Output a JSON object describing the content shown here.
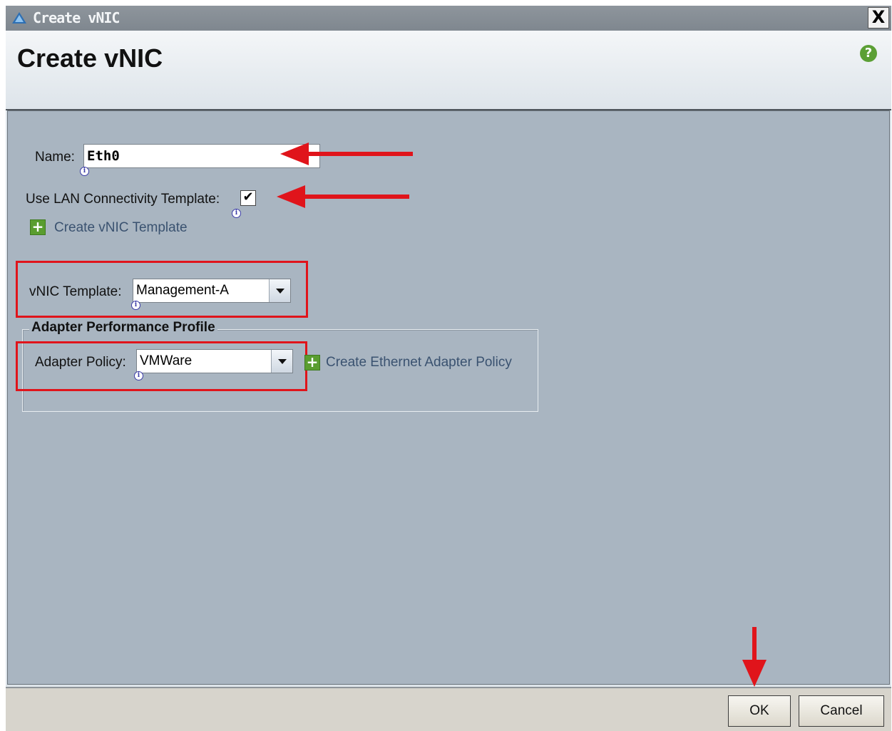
{
  "window": {
    "title": "Create vNIC",
    "close_label": "X"
  },
  "header": {
    "heading": "Create vNIC",
    "help_label": "?"
  },
  "form": {
    "name_label": "Name:",
    "name_value": "Eth0",
    "use_template_label": "Use LAN Connectivity Template:",
    "use_template_checked": true,
    "checkmark": "✔",
    "create_template_link": "Create vNIC Template",
    "vnic_template_label": "vNIC Template:",
    "vnic_template_value": "Management-A",
    "adapter_group_title": "Adapter Performance Profile",
    "adapter_policy_label": "Adapter Policy:",
    "adapter_policy_value": "VMWare",
    "create_adapter_policy_link": "Create Ethernet Adapter Policy",
    "info_glyph": "i",
    "plus_glyph": "+"
  },
  "footer": {
    "ok_label": "OK",
    "cancel_label": "Cancel"
  },
  "colors": {
    "annotation_red": "#e0141b",
    "content_bg": "#a9b5c1",
    "accent_green": "#5a9d2f"
  }
}
